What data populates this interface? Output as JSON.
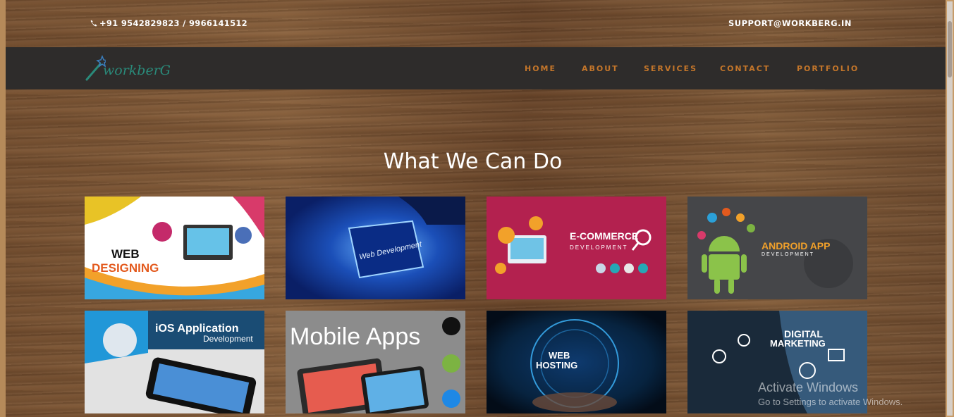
{
  "topbar": {
    "phone": "+91 9542829823 / 9966141512",
    "email": "SUPPORT@WORKBERG.IN"
  },
  "logo": {
    "text": "workberG"
  },
  "nav": {
    "items": [
      "HOME",
      "ABOUT",
      "SERVICES",
      "CONTACT",
      "PORTFOLIO"
    ]
  },
  "section": {
    "title": "What We Can Do"
  },
  "services": [
    {
      "line1": "WEB",
      "line2": "DESIGNING"
    },
    {
      "line1": "Web Development"
    },
    {
      "line1": "E-COMMERCE",
      "line2": "DEVELOPMENT"
    },
    {
      "line1": "ANDROID APP",
      "line2": "DEVELOPMENT"
    },
    {
      "line1": "iOS Application",
      "line2": "Development"
    },
    {
      "line1": "Mobile Apps"
    },
    {
      "line1": "WEB",
      "line2": "HOSTING"
    },
    {
      "line1": "DIGITAL",
      "line2": "MARKETING"
    }
  ],
  "watermark": {
    "line1": "Activate Windows",
    "line2": "Go to Settings to activate Windows."
  },
  "colors": {
    "nav_link": "#c4762a",
    "navbar_bg": "#2e2c2b"
  }
}
